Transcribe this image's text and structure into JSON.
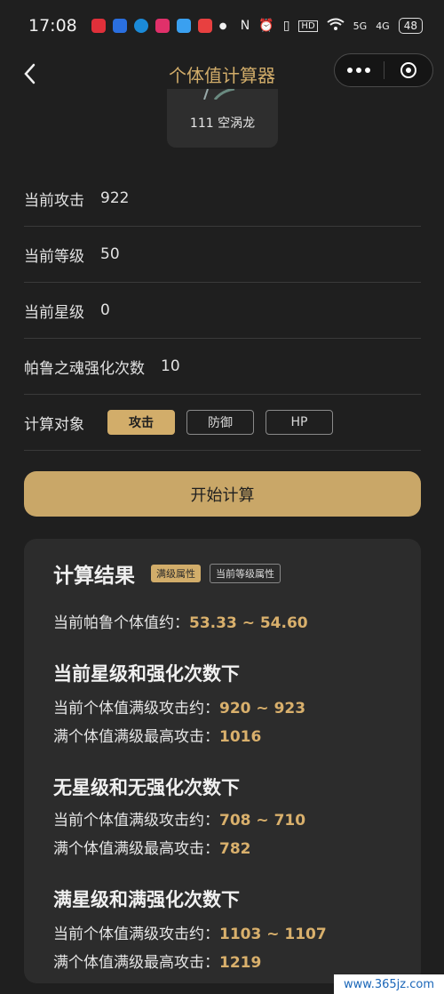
{
  "status": {
    "time": "17:08",
    "battery": "48",
    "network_5g_a": "5G",
    "network_5g_b": "4G",
    "hd": "HD"
  },
  "nav": {
    "title": "个体值计算器"
  },
  "pal": {
    "name": "111 空涡龙"
  },
  "form": {
    "attack": {
      "label": "当前攻击",
      "value": "922"
    },
    "level": {
      "label": "当前等级",
      "value": "50"
    },
    "star": {
      "label": "当前星级",
      "value": "0"
    },
    "soul": {
      "label": "帕鲁之魂强化次数",
      "value": "10"
    },
    "target": {
      "label": "计算对象",
      "options": [
        "攻击",
        "防御",
        "HP"
      ],
      "selected": "攻击"
    }
  },
  "start_button": "开始计算",
  "result": {
    "title": "计算结果",
    "tags": [
      "满级属性",
      "当前等级属性"
    ],
    "iv_label": "当前帕鲁个体值约：",
    "iv_value": "53.33 ~ 54.60",
    "sections": [
      {
        "title": "当前星级和强化次数下",
        "line1_label": "当前个体值满级攻击约：",
        "line1_value": "920 ~ 923",
        "line2_label": "满个体值满级最高攻击：",
        "line2_value": "1016"
      },
      {
        "title": "无星级和无强化次数下",
        "line1_label": "当前个体值满级攻击约：",
        "line1_value": "708 ~ 710",
        "line2_label": "满个体值满级最高攻击：",
        "line2_value": "782"
      },
      {
        "title": "满星级和满强化次数下",
        "line1_label": "当前个体值满级攻击约：",
        "line1_value": "1103 ~ 1107",
        "line2_label": "满个体值满级最高攻击：",
        "line2_value": "1219"
      }
    ]
  },
  "watermark": "www.365jz.com",
  "colors": {
    "accent": "#d2ad6a",
    "background": "#1f1f1f",
    "card": "#2c2c2c"
  }
}
